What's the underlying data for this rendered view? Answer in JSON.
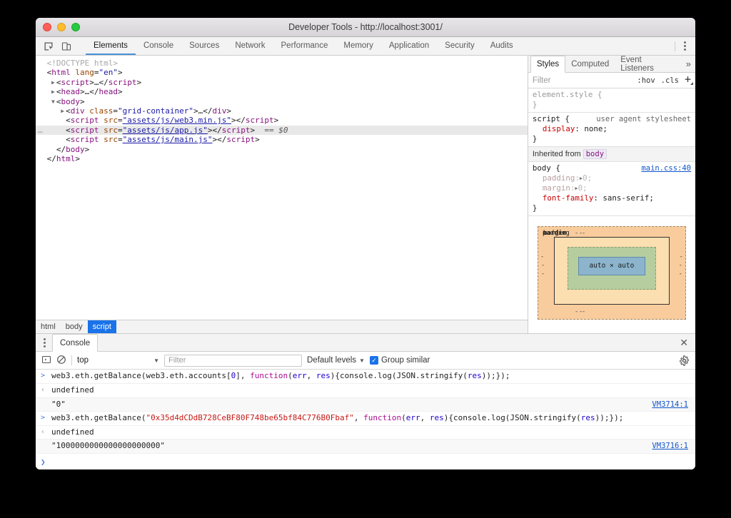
{
  "window": {
    "title": "Developer Tools - http://localhost:3001/",
    "traffic_lights": [
      "close-red",
      "minimize-yellow",
      "maximize-green"
    ]
  },
  "devtools_toolbar": {
    "inspect_icon": "inspect-element-icon",
    "device_toggle_icon": "device-toolbar-icon",
    "more_icon": "more-options-kebab-icon",
    "tabs": [
      {
        "label": "Elements",
        "active": true
      },
      {
        "label": "Console",
        "active": false
      },
      {
        "label": "Sources",
        "active": false
      },
      {
        "label": "Network",
        "active": false
      },
      {
        "label": "Performance",
        "active": false
      },
      {
        "label": "Memory",
        "active": false
      },
      {
        "label": "Application",
        "active": false
      },
      {
        "label": "Security",
        "active": false
      },
      {
        "label": "Audits",
        "active": false
      }
    ]
  },
  "dom_tree": {
    "rows": [
      {
        "indent": 0,
        "twisty": "",
        "selected": false,
        "gutter": "",
        "parts": [
          {
            "t": "doctype",
            "s": "<!DOCTYPE html>"
          }
        ]
      },
      {
        "indent": 0,
        "twisty": "",
        "selected": false,
        "gutter": "",
        "parts": [
          {
            "t": "punc",
            "s": "<"
          },
          {
            "t": "tag",
            "s": "html"
          },
          {
            "t": "attr",
            "s": " lang"
          },
          {
            "t": "punc",
            "s": "="
          },
          {
            "t": "val",
            "s": "\"en\""
          },
          {
            "t": "punc",
            "s": ">"
          }
        ]
      },
      {
        "indent": 1,
        "twisty": "collapsed",
        "selected": false,
        "gutter": "",
        "parts": [
          {
            "t": "punc",
            "s": "<"
          },
          {
            "t": "tag",
            "s": "script"
          },
          {
            "t": "punc",
            "s": ">"
          },
          {
            "t": "plain",
            "s": "…"
          },
          {
            "t": "punc",
            "s": "</"
          },
          {
            "t": "tag",
            "s": "script"
          },
          {
            "t": "punc",
            "s": ">"
          }
        ]
      },
      {
        "indent": 1,
        "twisty": "collapsed",
        "selected": false,
        "gutter": "",
        "parts": [
          {
            "t": "punc",
            "s": "<"
          },
          {
            "t": "tag",
            "s": "head"
          },
          {
            "t": "punc",
            "s": ">"
          },
          {
            "t": "plain",
            "s": "…"
          },
          {
            "t": "punc",
            "s": "</"
          },
          {
            "t": "tag",
            "s": "head"
          },
          {
            "t": "punc",
            "s": ">"
          }
        ]
      },
      {
        "indent": 1,
        "twisty": "expanded",
        "selected": false,
        "gutter": "",
        "parts": [
          {
            "t": "punc",
            "s": "<"
          },
          {
            "t": "tag",
            "s": "body"
          },
          {
            "t": "punc",
            "s": ">"
          }
        ]
      },
      {
        "indent": 2,
        "twisty": "collapsed",
        "selected": false,
        "gutter": "",
        "parts": [
          {
            "t": "punc",
            "s": "<"
          },
          {
            "t": "tag",
            "s": "div"
          },
          {
            "t": "attr",
            "s": " class"
          },
          {
            "t": "punc",
            "s": "="
          },
          {
            "t": "val",
            "s": "\"grid-container\""
          },
          {
            "t": "punc",
            "s": ">"
          },
          {
            "t": "plain",
            "s": "…"
          },
          {
            "t": "punc",
            "s": "</"
          },
          {
            "t": "tag",
            "s": "div"
          },
          {
            "t": "punc",
            "s": ">"
          }
        ]
      },
      {
        "indent": 2,
        "twisty": "",
        "selected": false,
        "gutter": "",
        "parts": [
          {
            "t": "punc",
            "s": "<"
          },
          {
            "t": "tag",
            "s": "script"
          },
          {
            "t": "attr",
            "s": " src"
          },
          {
            "t": "punc",
            "s": "="
          },
          {
            "t": "link",
            "s": "\"assets/js/web3.min.js\""
          },
          {
            "t": "punc",
            "s": "></"
          },
          {
            "t": "tag",
            "s": "script"
          },
          {
            "t": "punc",
            "s": ">"
          }
        ]
      },
      {
        "indent": 2,
        "twisty": "",
        "selected": true,
        "gutter": "…",
        "parts": [
          {
            "t": "punc",
            "s": "<"
          },
          {
            "t": "tag",
            "s": "script"
          },
          {
            "t": "attr",
            "s": " src"
          },
          {
            "t": "punc",
            "s": "="
          },
          {
            "t": "link",
            "s": "\"assets/js/app.js\""
          },
          {
            "t": "punc",
            "s": "></"
          },
          {
            "t": "tag",
            "s": "script"
          },
          {
            "t": "punc",
            "s": ">"
          },
          {
            "t": "dollar",
            "s": "  == $0"
          }
        ]
      },
      {
        "indent": 2,
        "twisty": "",
        "selected": false,
        "gutter": "",
        "parts": [
          {
            "t": "punc",
            "s": "<"
          },
          {
            "t": "tag",
            "s": "script"
          },
          {
            "t": "attr",
            "s": " src"
          },
          {
            "t": "punc",
            "s": "="
          },
          {
            "t": "link",
            "s": "\"assets/js/main.js\""
          },
          {
            "t": "punc",
            "s": "></"
          },
          {
            "t": "tag",
            "s": "script"
          },
          {
            "t": "punc",
            "s": ">"
          }
        ]
      },
      {
        "indent": 1,
        "twisty": "",
        "selected": false,
        "gutter": "",
        "parts": [
          {
            "t": "punc",
            "s": "</"
          },
          {
            "t": "tag",
            "s": "body"
          },
          {
            "t": "punc",
            "s": ">"
          }
        ]
      },
      {
        "indent": 0,
        "twisty": "",
        "selected": false,
        "gutter": "",
        "parts": [
          {
            "t": "punc",
            "s": "</"
          },
          {
            "t": "tag",
            "s": "html"
          },
          {
            "t": "punc",
            "s": ">"
          }
        ]
      }
    ],
    "breadcrumbs": [
      {
        "label": "html",
        "active": false
      },
      {
        "label": "body",
        "active": false
      },
      {
        "label": "script",
        "active": true
      }
    ]
  },
  "styles_panel": {
    "tabs": [
      {
        "label": "Styles",
        "active": true
      },
      {
        "label": "Computed",
        "active": false
      },
      {
        "label": "Event Listeners",
        "active": false
      }
    ],
    "more_tabs_glyph": "»",
    "filter_placeholder": "Filter",
    "hov_label": ":hov",
    "cls_label": ".cls",
    "new_rule_icon": "add-style-rule-icon",
    "rules": [
      {
        "selector": "element.style",
        "origin": "",
        "origin_link": "",
        "grey": true,
        "declarations": []
      },
      {
        "selector": "script",
        "origin": "user agent stylesheet",
        "origin_link": "",
        "grey": false,
        "declarations": [
          {
            "name": "display",
            "value": "none",
            "disabled": false,
            "expandable": false
          }
        ]
      }
    ],
    "inherited_label": "Inherited from",
    "inherited_from": "body",
    "inherited_rule": {
      "selector": "body",
      "origin_link": "main.css:40",
      "declarations": [
        {
          "name": "padding",
          "value": "0",
          "disabled": true,
          "expandable": true
        },
        {
          "name": "margin",
          "value": "0",
          "disabled": true,
          "expandable": true
        },
        {
          "name": "font-family",
          "value": "sans-serif",
          "disabled": false,
          "expandable": false
        }
      ]
    },
    "box_model": {
      "margin_label": "margin",
      "border_label": "border",
      "padding_label": "padding",
      "content_label": "auto × auto",
      "margin_values": {
        "top": "-",
        "right": "-",
        "bottom": "-",
        "left": "-"
      },
      "border_values": {
        "top": "-",
        "right": "-",
        "bottom": "-",
        "left": "-"
      },
      "padding_values": {
        "top": "-",
        "right": "-",
        "bottom": "-",
        "left": "-"
      },
      "colors": {
        "margin": "#f9cc9d",
        "border": "#fcdfb0",
        "padding": "#b5cd9f",
        "content": "#8cb4cd"
      }
    }
  },
  "console_drawer": {
    "kebab_icon": "drawer-more-icon",
    "tab_label": "Console",
    "close_icon": "close-drawer-icon",
    "toolbar": {
      "sidebar_icon": "console-sidebar-icon",
      "clear_icon": "clear-console-icon",
      "context": "top",
      "context_arrow": "▼",
      "filter_placeholder": "Filter",
      "levels_label": "Default levels",
      "levels_arrow": "▼",
      "group_similar_label": "Group similar",
      "group_similar_checked": true,
      "settings_icon": "console-settings-gear-icon"
    },
    "entries": [
      {
        "kind": "input",
        "gutter": ">",
        "vm": "",
        "tokens": [
          {
            "t": "plain",
            "s": "web3.eth.getBalance(web3.eth.accounts["
          },
          {
            "t": "num",
            "s": "0"
          },
          {
            "t": "plain",
            "s": "], "
          },
          {
            "t": "kw",
            "s": "function"
          },
          {
            "t": "plain",
            "s": "("
          },
          {
            "t": "par",
            "s": "err"
          },
          {
            "t": "plain",
            "s": ", "
          },
          {
            "t": "par",
            "s": "res"
          },
          {
            "t": "plain",
            "s": "){console.log(JSON.stringify("
          },
          {
            "t": "par",
            "s": "res"
          },
          {
            "t": "plain",
            "s": "));});"
          }
        ]
      },
      {
        "kind": "result",
        "gutter": "‹",
        "vm": "",
        "tokens": [
          {
            "t": "plain",
            "s": "undefined"
          }
        ]
      },
      {
        "kind": "log",
        "gutter": "",
        "vm": "VM3714:1",
        "tokens": [
          {
            "t": "plain",
            "s": "\"0\""
          }
        ]
      },
      {
        "kind": "input",
        "gutter": ">",
        "vm": "",
        "tokens": [
          {
            "t": "plain",
            "s": "web3.eth.getBalance("
          },
          {
            "t": "str",
            "s": "\"0x35d4dCDdB728CeBF80F748be65bf84C776B0Fbaf\""
          },
          {
            "t": "plain",
            "s": ", "
          },
          {
            "t": "kw",
            "s": "function"
          },
          {
            "t": "plain",
            "s": "("
          },
          {
            "t": "par",
            "s": "err"
          },
          {
            "t": "plain",
            "s": ", "
          },
          {
            "t": "par",
            "s": "res"
          },
          {
            "t": "plain",
            "s": "){console.log(JSON.stringify("
          },
          {
            "t": "par",
            "s": "res"
          },
          {
            "t": "plain",
            "s": "));});"
          }
        ]
      },
      {
        "kind": "result",
        "gutter": "‹",
        "vm": "",
        "tokens": [
          {
            "t": "plain",
            "s": "undefined"
          }
        ]
      },
      {
        "kind": "log",
        "gutter": "",
        "vm": "VM3716:1",
        "tokens": [
          {
            "t": "plain",
            "s": "\"1000000000000000000000\""
          }
        ]
      }
    ],
    "prompt_glyph": "❯"
  }
}
